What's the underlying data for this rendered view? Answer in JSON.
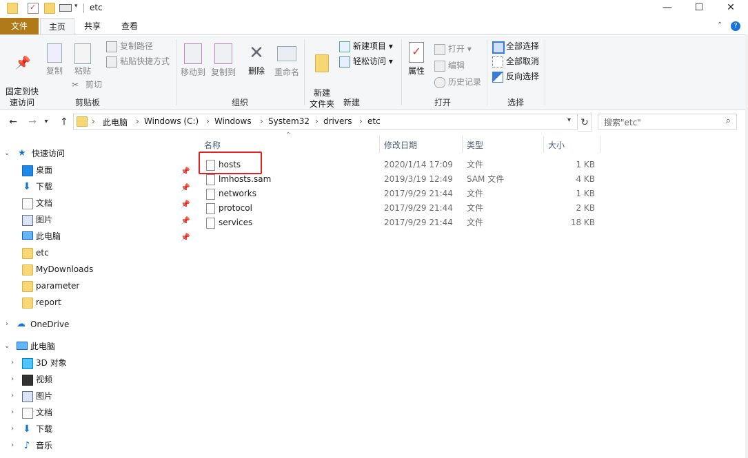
{
  "window": {
    "title": "etc"
  },
  "ribbon_tabs": {
    "file": "文件",
    "home": "主页",
    "share": "共享",
    "view": "查看"
  },
  "clipboard": {
    "pin": "固定到快\n速访问",
    "copy": "复制",
    "paste": "粘贴",
    "copy_path": "复制路径",
    "paste_shortcut": "粘贴快捷方式",
    "cut": "剪切",
    "label": "剪贴板"
  },
  "organize": {
    "move_to": "移动到",
    "copy_to": "复制到",
    "delete": "删除",
    "rename": "重命名",
    "label": "组织"
  },
  "new_group": {
    "new_folder": "新建\n文件夹",
    "new_item": "新建项目",
    "easy_access": "轻松访问",
    "label": "新建"
  },
  "open_group": {
    "properties": "属性",
    "open": "打开",
    "edit": "编辑",
    "history": "历史记录",
    "label": "打开"
  },
  "select_group": {
    "select_all": "全部选择",
    "select_none": "全部取消",
    "invert": "反向选择",
    "label": "选择"
  },
  "breadcrumb": [
    "此电脑",
    "Windows (C:)",
    "Windows",
    "System32",
    "drivers",
    "etc"
  ],
  "search": {
    "placeholder": "搜索\"etc\""
  },
  "nav": {
    "quick_access": "快速访问",
    "quick_items": [
      {
        "label": "桌面",
        "icon": "desktop-icon",
        "pinned": true
      },
      {
        "label": "下载",
        "icon": "download-icon",
        "pinned": true
      },
      {
        "label": "文档",
        "icon": "document-icon",
        "pinned": true
      },
      {
        "label": "图片",
        "icon": "picture-icon",
        "pinned": true
      },
      {
        "label": "此电脑",
        "icon": "computer-icon",
        "pinned": true
      },
      {
        "label": "etc",
        "icon": "folder-icon",
        "pinned": false
      },
      {
        "label": "MyDownloads",
        "icon": "folder-icon",
        "pinned": false
      },
      {
        "label": "parameter",
        "icon": "folder-icon",
        "pinned": false
      },
      {
        "label": "report",
        "icon": "folder-icon",
        "pinned": false
      }
    ],
    "onedrive": "OneDrive",
    "this_pc": "此电脑",
    "pc_items": [
      {
        "label": "3D 对象",
        "icon": "3d-objects-icon"
      },
      {
        "label": "视频",
        "icon": "video-icon"
      },
      {
        "label": "图片",
        "icon": "picture-icon"
      },
      {
        "label": "文档",
        "icon": "document-icon"
      },
      {
        "label": "下载",
        "icon": "download-icon"
      },
      {
        "label": "音乐",
        "icon": "music-icon"
      }
    ]
  },
  "columns": {
    "name": "名称",
    "modified": "修改日期",
    "type": "类型",
    "size": "大小"
  },
  "files": [
    {
      "name": "hosts",
      "modified": "2020/1/14 17:09",
      "type": "文件",
      "size": "1 KB"
    },
    {
      "name": "lmhosts.sam",
      "modified": "2019/3/19 12:49",
      "type": "SAM 文件",
      "size": "4 KB"
    },
    {
      "name": "networks",
      "modified": "2017/9/29 21:44",
      "type": "文件",
      "size": "1 KB"
    },
    {
      "name": "protocol",
      "modified": "2017/9/29 21:44",
      "type": "文件",
      "size": "2 KB"
    },
    {
      "name": "services",
      "modified": "2017/9/29 21:44",
      "type": "文件",
      "size": "18 KB"
    }
  ],
  "colors": {
    "file_tab": "#b07a1a",
    "highlight": "#e02020",
    "accent": "#0a64c8"
  }
}
